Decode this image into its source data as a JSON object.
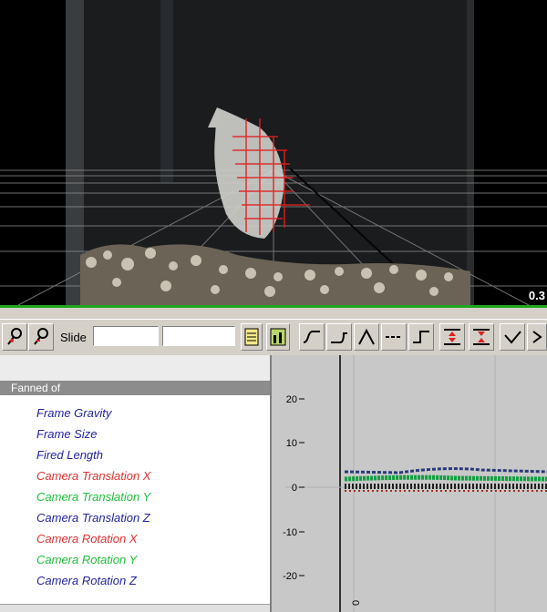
{
  "viewport": {
    "readout": "0.3"
  },
  "toolbar": {
    "tool_icons": [
      "key-add-icon",
      "key-remove-icon"
    ],
    "field_label": "Slide",
    "field1_value": "",
    "field2_value": "",
    "view_icons": [
      "sheet-icon",
      "bars-icon"
    ],
    "curve_icons": [
      "curve-s-icon",
      "curve-step-out-icon",
      "curve-peak-icon",
      "curve-flat-icon",
      "curve-step-icon",
      "compress-icon",
      "expand-icon",
      "checkmark-icon"
    ]
  },
  "channel_list": {
    "header": "Fanned of",
    "items": [
      {
        "label": "Frame Gravity",
        "color": "#2323a0"
      },
      {
        "label": "Frame Size",
        "color": "#2323a0"
      },
      {
        "label": "Fired Length",
        "color": "#2323a0"
      },
      {
        "label": "Camera Translation X",
        "color": "#e03030"
      },
      {
        "label": "Camera Translation Y",
        "color": "#1fbf3a"
      },
      {
        "label": "Camera Translation Z",
        "color": "#2323a0"
      },
      {
        "label": "Camera Rotation X",
        "color": "#e03030"
      },
      {
        "label": "Camera Rotation Y",
        "color": "#1fbf3a"
      },
      {
        "label": "Camera Rotation Z",
        "color": "#2323a0"
      }
    ]
  },
  "graph": {
    "y_ticks": [
      "20",
      "10",
      "0",
      "-10",
      "-20"
    ],
    "x_tick": "0"
  }
}
